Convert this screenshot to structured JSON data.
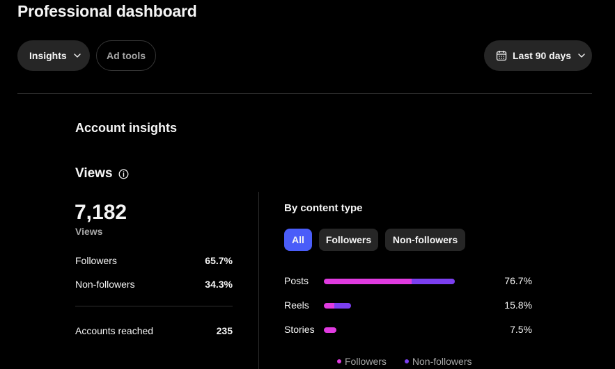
{
  "header": {
    "title": "Professional dashboard",
    "tabs": [
      {
        "label": "Insights",
        "selected": true
      },
      {
        "label": "Ad tools",
        "selected": false
      }
    ],
    "date_range": "Last 90 days"
  },
  "account_insights": {
    "title": "Account insights",
    "views": {
      "heading": "Views",
      "total": "7,182",
      "total_label": "Views",
      "rows": [
        {
          "label": "Followers",
          "value": "65.7%"
        },
        {
          "label": "Non-followers",
          "value": "34.3%"
        }
      ],
      "accounts_reached": {
        "label": "Accounts reached",
        "value": "235"
      }
    },
    "by_content_type": {
      "title": "By content type",
      "filters": [
        {
          "label": "All",
          "active": true
        },
        {
          "label": "Followers",
          "active": false
        },
        {
          "label": "Non-followers",
          "active": false
        }
      ],
      "rows": [
        {
          "label": "Posts",
          "value": "76.7%",
          "total": 76.7,
          "followers_share": 0.67
        },
        {
          "label": "Reels",
          "value": "15.8%",
          "total": 15.8,
          "followers_share": 0.38
        },
        {
          "label": "Stories",
          "value": "7.5%",
          "total": 7.5,
          "followers_share": 1.0
        }
      ],
      "legend": [
        {
          "label": "Followers",
          "color": "#e03be0"
        },
        {
          "label": "Non-followers",
          "color": "#7b3ff0"
        }
      ]
    }
  },
  "colors": {
    "accent": "#4a5df9",
    "followers": "#e03be0",
    "non_followers": "#7b3ff0",
    "background": "#000000",
    "pill": "#262626"
  }
}
